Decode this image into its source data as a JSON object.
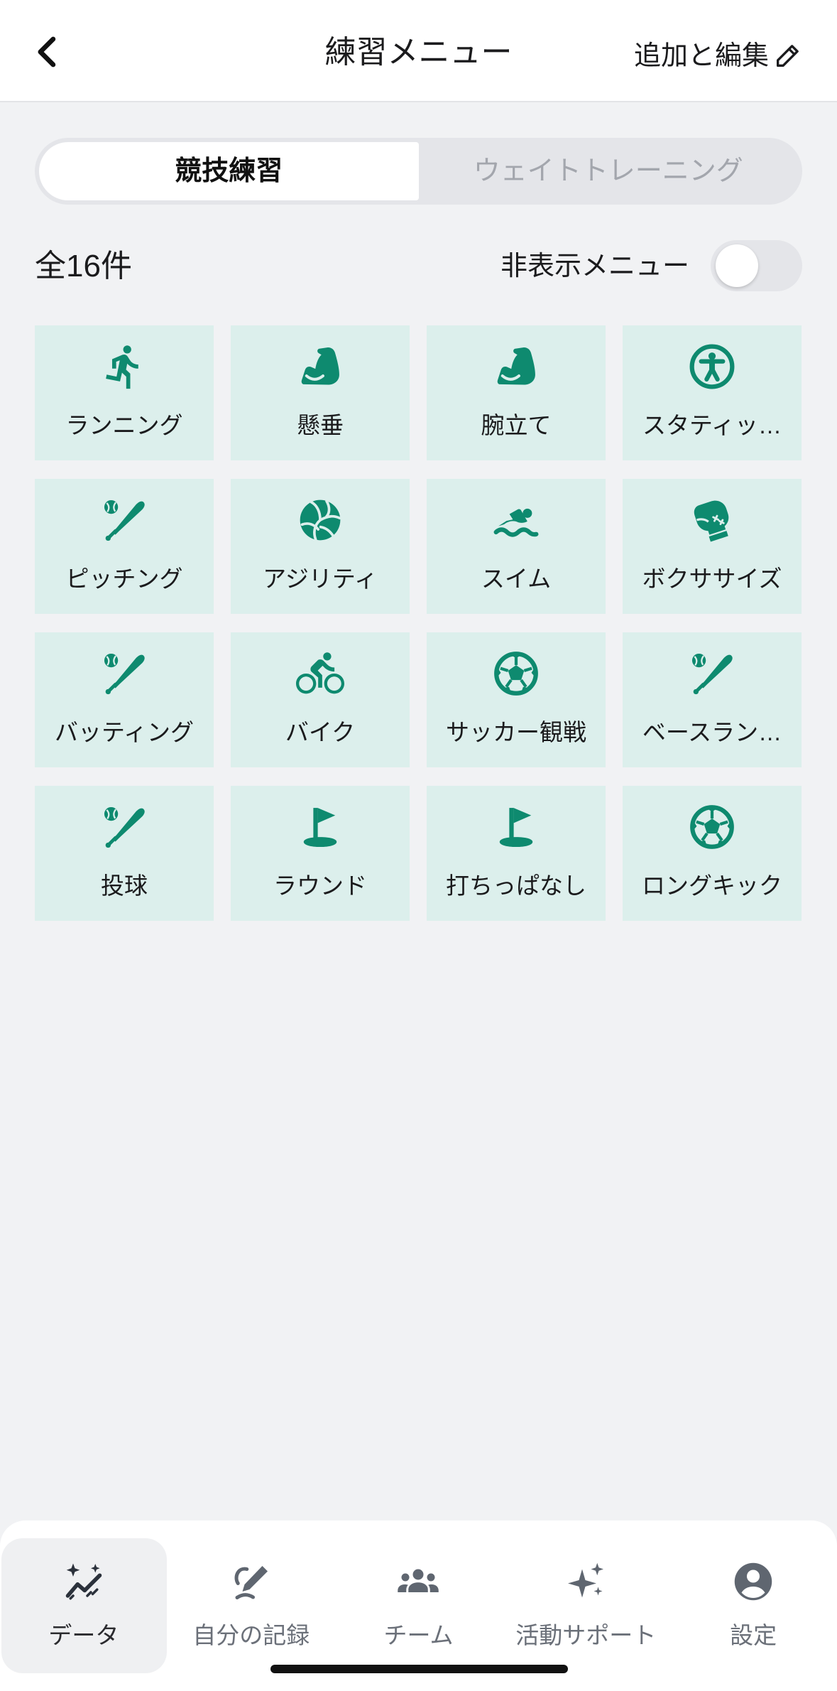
{
  "header": {
    "title": "練習メニュー",
    "edit_label": "追加と編集",
    "back_icon": "chevron-left-icon",
    "edit_icon": "pencil-icon"
  },
  "tabs": [
    {
      "label": "競技練習",
      "active": true
    },
    {
      "label": "ウェイトトレーニング",
      "active": false
    }
  ],
  "summary": {
    "count_label": "全16件",
    "hidden_menu_label": "非表示メニュー",
    "hidden_menu_toggle_on": false
  },
  "menu_items": [
    {
      "label": "ランニング",
      "icon": "running-icon"
    },
    {
      "label": "懸垂",
      "icon": "flexed-arm-icon"
    },
    {
      "label": "腕立て",
      "icon": "flexed-arm-icon"
    },
    {
      "label": "スタティッ…",
      "icon": "accessibility-icon"
    },
    {
      "label": "ピッチング",
      "icon": "baseball-bat-icon"
    },
    {
      "label": "アジリティ",
      "icon": "volleyball-icon"
    },
    {
      "label": "スイム",
      "icon": "swimming-icon"
    },
    {
      "label": "ボクササイズ",
      "icon": "boxing-glove-icon"
    },
    {
      "label": "バッティング",
      "icon": "baseball-bat-icon"
    },
    {
      "label": "バイク",
      "icon": "cycling-icon"
    },
    {
      "label": "サッカー観戦",
      "icon": "soccer-ball-icon"
    },
    {
      "label": "ベースラン…",
      "icon": "baseball-bat-icon"
    },
    {
      "label": "投球",
      "icon": "baseball-bat-icon"
    },
    {
      "label": "ラウンド",
      "icon": "golf-flag-icon"
    },
    {
      "label": "打ちっぱなし",
      "icon": "golf-flag-icon"
    },
    {
      "label": "ロングキック",
      "icon": "soccer-ball-icon"
    }
  ],
  "bottom_nav": [
    {
      "label": "データ",
      "icon": "chart-sparkle-icon",
      "active": true
    },
    {
      "label": "自分の記録",
      "icon": "pen-icon",
      "active": false
    },
    {
      "label": "チーム",
      "icon": "group-icon",
      "active": false
    },
    {
      "label": "活動サポート",
      "icon": "sparkles-icon",
      "active": false
    },
    {
      "label": "設定",
      "icon": "account-circle-icon",
      "active": false
    }
  ],
  "colors": {
    "background": "#f1f2f4",
    "tile_background": "#dcefec",
    "icon_accent": "#0e8a6f",
    "segment_track": "#e4e5e9",
    "inactive_text": "#a3a6ad",
    "nav_active_background": "#eff0f2"
  }
}
